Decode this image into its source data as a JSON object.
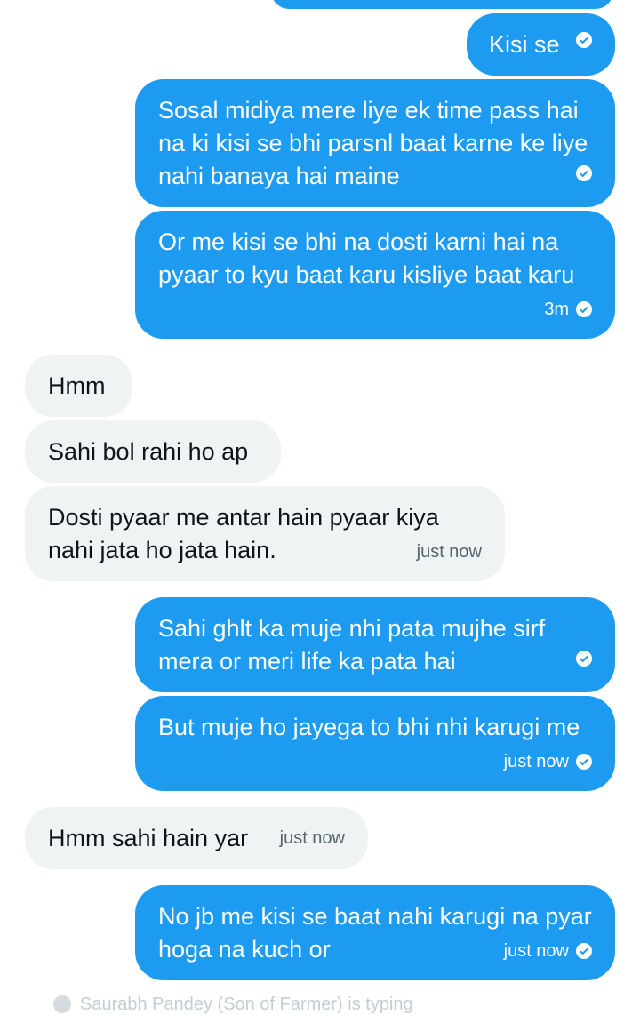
{
  "messages": [
    {
      "side": "out",
      "text": "Kisi se",
      "time": ""
    },
    {
      "side": "out",
      "text": "Sosal midiya mere liye ek time pass hai na ki kisi se bhi parsnl baat karne ke liye nahi banaya hai maine",
      "time": ""
    },
    {
      "side": "out",
      "text": "Or me kisi se bhi na dosti karni hai na pyaar to kyu baat karu kisliye baat karu",
      "time": "3m"
    },
    {
      "side": "in",
      "text": "Hmm",
      "time": ""
    },
    {
      "side": "in",
      "text": "Sahi bol rahi ho ap",
      "time": ""
    },
    {
      "side": "in",
      "text": "Dosti pyaar me antar hain pyaar kiya nahi jata ho jata hain.",
      "time": "just now"
    },
    {
      "side": "out",
      "text": "Sahi ghlt ka muje nhi pata mujhe sirf mera or meri life ka pata hai",
      "time": ""
    },
    {
      "side": "out",
      "text": "But muje ho jayega to bhi nhi karugi me",
      "time": "just now"
    },
    {
      "side": "in",
      "text": "Hmm sahi hain yar",
      "time": "just now"
    },
    {
      "side": "out",
      "text": "No jb me kisi se baat nahi karugi na pyar hoga na kuch or",
      "time": "just now"
    }
  ],
  "reaction_preview": "Saurabh Pandey (Son of Farmer) is typing",
  "icons": {
    "delivered": "check-circle-icon"
  },
  "colors": {
    "outgoing": "#1d9bf0",
    "incoming": "#eff3f4",
    "meta_incoming": "#536471"
  }
}
